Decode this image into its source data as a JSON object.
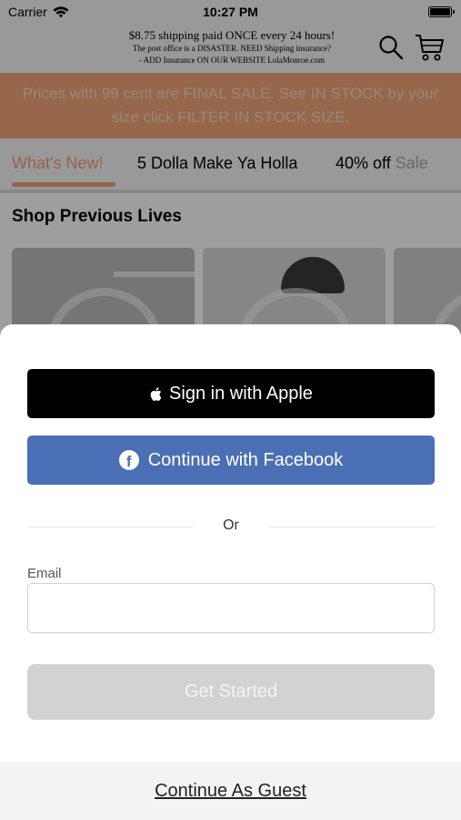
{
  "status_bar": {
    "carrier": "Carrier",
    "time": "10:27 PM"
  },
  "header": {
    "line1": "$8.75 shipping paid ONCE every 24 hours!",
    "line2": "The post office is a DISASTER. NEED Shipping insurance?",
    "line3": "- ADD Insurance ON OUR WEBSITE LolaMonroe.com"
  },
  "banner": {
    "text": "Prices with 99 cent are FINAL SALE. See IN STOCK by your size click FILTER IN STOCK SIZE."
  },
  "tabs": [
    {
      "label": "What's New!"
    },
    {
      "label": "5 Dolla Make Ya Holla"
    },
    {
      "label_start": "40% off ",
      "label_faded": "Sale"
    }
  ],
  "section": {
    "title": "Shop Previous Lives"
  },
  "sheet": {
    "apple_button": "Sign in with Apple",
    "facebook_button": "Continue with Facebook",
    "divider": "Or",
    "email_label": "Email",
    "email_value": "",
    "email_placeholder": "",
    "get_started_button": "Get Started",
    "guest_link": "Continue As Guest"
  },
  "colors": {
    "accent": "#f0a07a",
    "banner": "#f2a77a",
    "facebook": "#4a6fb5",
    "disabled_button": "#d2d2d2"
  },
  "icons": {
    "wifi": "wifi-icon",
    "battery": "battery-icon",
    "search": "search-icon",
    "cart": "cart-icon",
    "apple": "apple-icon",
    "facebook": "facebook-icon"
  }
}
